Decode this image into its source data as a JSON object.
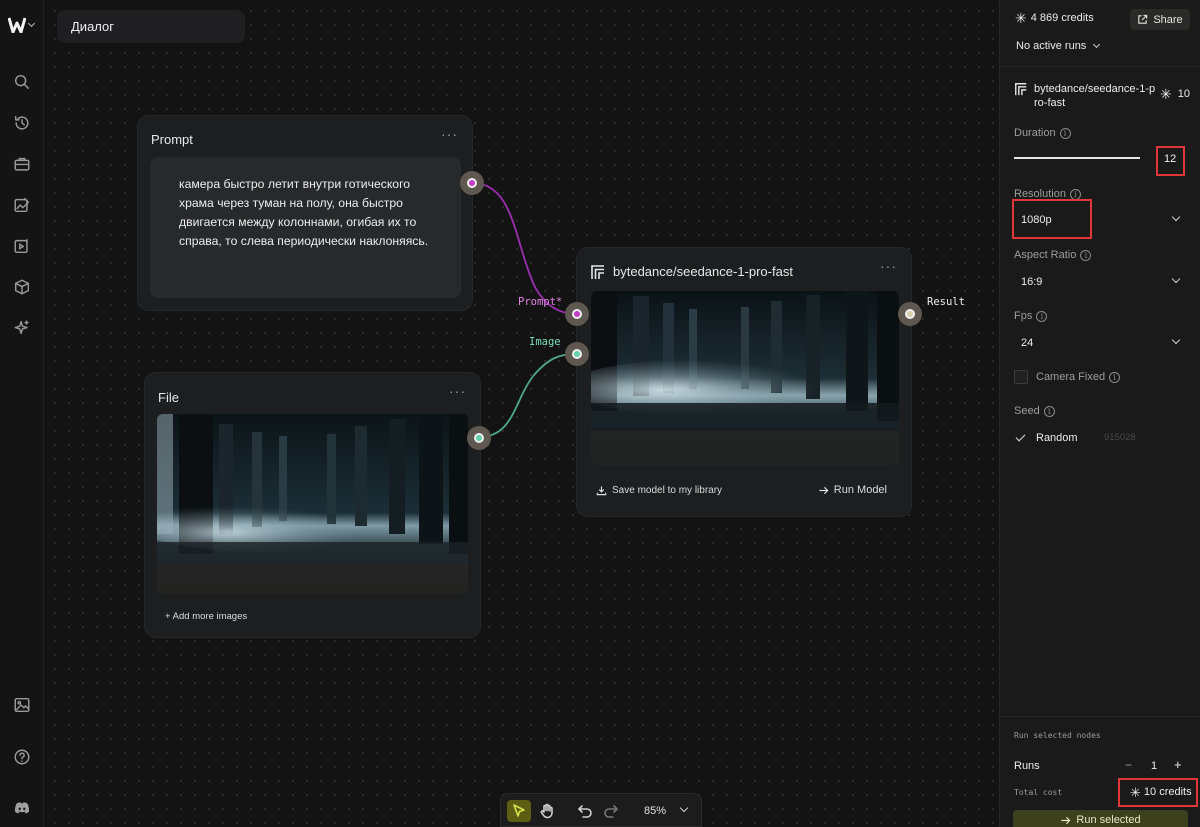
{
  "canvas": {
    "tab_title": "Диалог",
    "prompt_node": {
      "title": "Prompt",
      "menu": "···",
      "text": "камера быстро летит внутри готического храма через туман на полу, она быстро двигается между колоннами, огибая их то справа, то слева периодически наклоняясь."
    },
    "file_node": {
      "title": "File",
      "menu": "···",
      "add_more": "+ Add more images"
    },
    "model_node": {
      "title": "bytedance/seedance-1-pro-fast",
      "menu": "···",
      "input_prompt_label": "Prompt*",
      "input_image_label": "Image",
      "output_label": "Result",
      "save_label": "Save model to my library",
      "run_label": "Run Model"
    }
  },
  "toolbar": {
    "zoom": "85%"
  },
  "panel": {
    "credits": "4 869 credits",
    "share_label": "Share",
    "active_runs": "No active runs",
    "model_name": "bytedance/seedance-1-pro-fast",
    "model_cost": "10",
    "duration_label": "Duration",
    "duration_value": "12",
    "resolution_label": "Resolution",
    "resolution_value": "1080p",
    "aspect_label": "Aspect Ratio",
    "aspect_value": "16:9",
    "fps_label": "Fps",
    "fps_value": "24",
    "camera_fixed_label": "Camera Fixed",
    "seed_label": "Seed",
    "seed_random_label": "Random",
    "seed_value": "915028",
    "run_selected_nodes": "Run selected nodes",
    "runs_label": "Runs",
    "runs_minus": "−",
    "runs_value": "1",
    "runs_plus": "+",
    "total_cost_label": "Total cost",
    "total_cost_value": "10 credits",
    "run_button": "Run selected"
  },
  "colors": {
    "accent_prompt": "#c23bc7",
    "accent_image": "#5fd1a8",
    "highlight_red": "#e03838"
  }
}
